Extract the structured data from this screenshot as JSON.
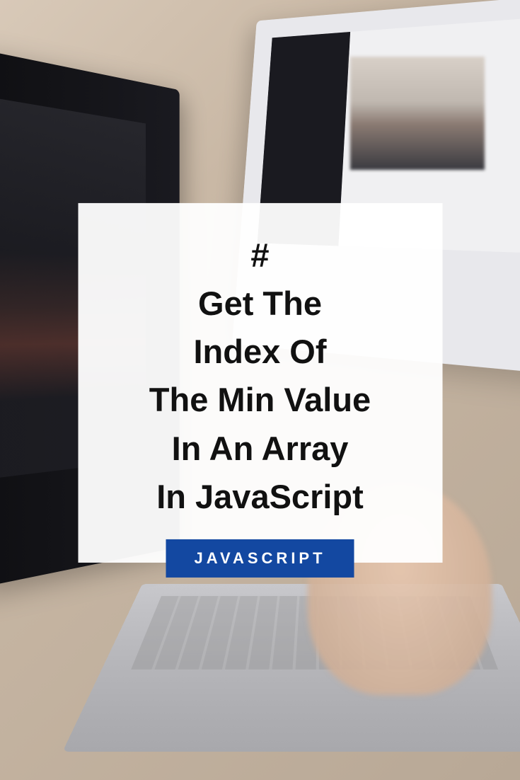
{
  "title": "#\nGet The\nIndex Of\nThe Min Value\nIn An Array\nIn JavaScript",
  "tag": "JAVASCRIPT"
}
